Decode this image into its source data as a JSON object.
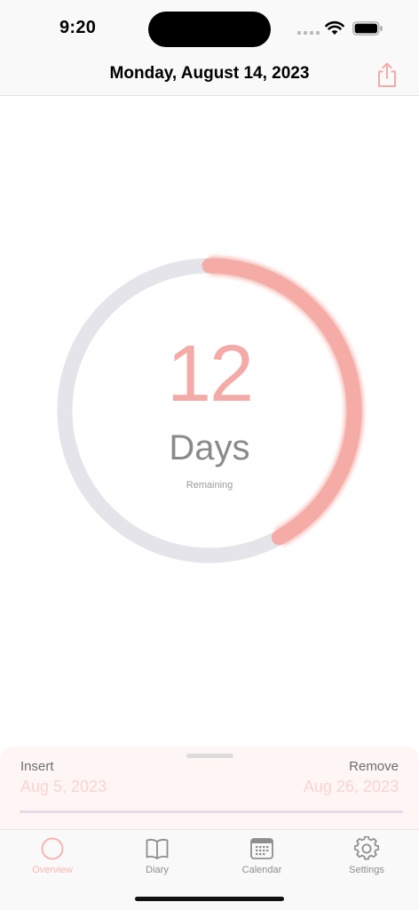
{
  "status_bar": {
    "time": "9:20"
  },
  "header": {
    "title": "Monday, August 14, 2023",
    "share_icon": "share-icon"
  },
  "countdown": {
    "value": "12",
    "unit": "Days",
    "caption": "Remaining",
    "progress_fraction": 0.42
  },
  "sheet": {
    "insert_label": "Insert",
    "insert_date": "Aug 5, 2023",
    "remove_label": "Remove",
    "remove_date": "Aug 26, 2023"
  },
  "tabs": [
    {
      "label": "Overview",
      "icon": "circle-icon",
      "active": true
    },
    {
      "label": "Diary",
      "icon": "book-icon",
      "active": false
    },
    {
      "label": "Calendar",
      "icon": "calendar-icon",
      "active": false
    },
    {
      "label": "Settings",
      "icon": "gear-icon",
      "active": false
    }
  ],
  "colors": {
    "accent": "#f4aaa6",
    "accent_light": "#fbd3cf",
    "track": "#e4e4ea"
  }
}
